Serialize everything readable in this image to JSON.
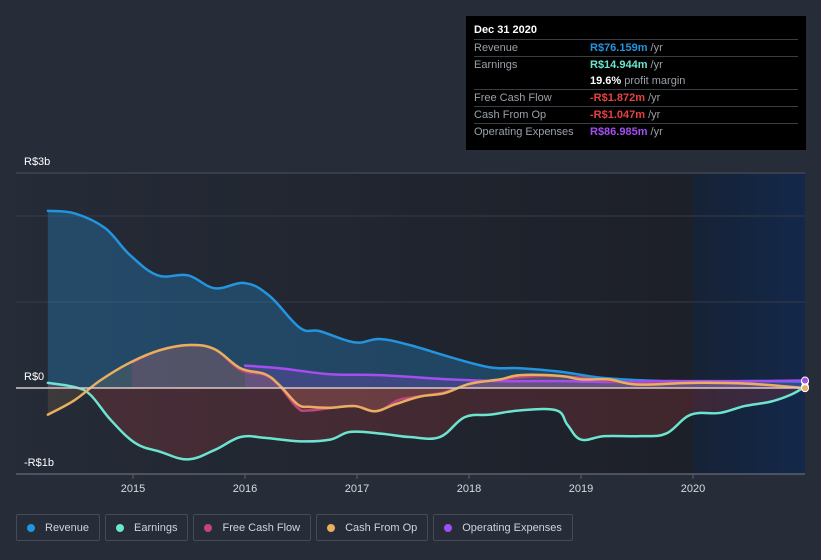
{
  "tooltip": {
    "date": "Dec 31 2020",
    "rows": [
      {
        "label": "Revenue",
        "value": "R$76.159m",
        "unit": " /yr",
        "color": "#2394df"
      },
      {
        "label": "Earnings",
        "value": "R$14.944m",
        "unit": " /yr",
        "color": "#6ce5d0"
      },
      {
        "label": "",
        "value": "19.6%",
        "unit": " profit margin",
        "color": "#ffffff"
      },
      {
        "label": "Free Cash Flow",
        "value": "-R$1.872m",
        "unit": " /yr",
        "color": "#e64141"
      },
      {
        "label": "Cash From Op",
        "value": "-R$1.047m",
        "unit": " /yr",
        "color": "#e64141"
      },
      {
        "label": "Operating Expenses",
        "value": "R$86.985m",
        "unit": " /yr",
        "color": "#a44ef0"
      }
    ]
  },
  "legend": [
    {
      "label": "Revenue",
      "color": "#2394df"
    },
    {
      "label": "Earnings",
      "color": "#6ce5d0"
    },
    {
      "label": "Free Cash Flow",
      "color": "#c0457f"
    },
    {
      "label": "Cash From Op",
      "color": "#e8af5e"
    },
    {
      "label": "Operating Expenses",
      "color": "#a44ef0"
    }
  ],
  "chart_data": {
    "type": "area",
    "title": "",
    "xlabel": "",
    "ylabel": "",
    "y_unit": "R$ billions",
    "ylim": [
      -1,
      2.5
    ],
    "xlim": [
      2014.24,
      2021.0
    ],
    "y_tick_labels": [
      {
        "value": 2.5,
        "label": "R$3b"
      },
      {
        "value": 0,
        "label": "R$0"
      },
      {
        "value": -1,
        "label": "-R$1b"
      }
    ],
    "gridlines": [
      2.5,
      2,
      1,
      0,
      -1
    ],
    "x_ticks": [
      2015,
      2016,
      2017,
      2018,
      2019,
      2020
    ],
    "x_tick_labels": [
      "2015",
      "2016",
      "2017",
      "2018",
      "2019",
      "2020"
    ],
    "highlight_range": [
      2020,
      2021.0
    ],
    "grid": true,
    "legend_position": "bottom-left",
    "series": [
      {
        "name": "Revenue",
        "color": "#2394df",
        "x": [
          2014.24,
          2014.48,
          2014.75,
          2014.97,
          2015.22,
          2015.49,
          2015.73,
          2016.0,
          2016.22,
          2016.49,
          2016.67,
          2016.98,
          2017.2,
          2017.47,
          2017.83,
          2018.19,
          2018.46,
          2018.81,
          2019.17,
          2019.53,
          2020.06,
          2020.5,
          2021.0
        ],
        "values": [
          2.06,
          2.03,
          1.86,
          1.55,
          1.31,
          1.31,
          1.16,
          1.22,
          1.07,
          0.7,
          0.66,
          0.53,
          0.57,
          0.5,
          0.36,
          0.24,
          0.23,
          0.19,
          0.12,
          0.09,
          0.07,
          0.08,
          0.076
        ]
      },
      {
        "name": "Earnings",
        "color": "#6ce5d0",
        "x": [
          2014.24,
          2014.48,
          2014.62,
          2014.8,
          2015.02,
          2015.24,
          2015.49,
          2015.73,
          2015.96,
          2016.18,
          2016.49,
          2016.76,
          2016.94,
          2017.21,
          2017.47,
          2017.74,
          2017.96,
          2018.19,
          2018.46,
          2018.78,
          2018.88,
          2019.0,
          2019.21,
          2019.53,
          2019.76,
          2019.98,
          2020.24,
          2020.46,
          2020.69,
          2020.87,
          2021.0
        ],
        "values": [
          0.06,
          0.01,
          -0.08,
          -0.37,
          -0.64,
          -0.74,
          -0.83,
          -0.72,
          -0.57,
          -0.58,
          -0.62,
          -0.6,
          -0.51,
          -0.53,
          -0.57,
          -0.57,
          -0.34,
          -0.31,
          -0.26,
          -0.26,
          -0.43,
          -0.6,
          -0.56,
          -0.56,
          -0.53,
          -0.31,
          -0.29,
          -0.21,
          -0.16,
          -0.08,
          0.015
        ]
      },
      {
        "name": "Free Cash Flow",
        "color": "#c0457f",
        "x": [
          2014.99,
          2015.24,
          2015.49,
          2015.73,
          2015.96,
          2016.18,
          2016.31,
          2016.47,
          2016.58,
          2016.96,
          2017.18,
          2017.37,
          2017.55,
          2017.78,
          2018.01,
          2018.28,
          2018.64,
          2019.0,
          2019.5,
          2020.0,
          2020.5,
          2021.0
        ],
        "values": [
          0.3,
          0.44,
          0.5,
          0.45,
          0.21,
          0.15,
          0.02,
          -0.23,
          -0.26,
          -0.21,
          -0.27,
          -0.14,
          -0.1,
          -0.05,
          0.05,
          0.1,
          0.14,
          0.12,
          0.05,
          0.06,
          0.05,
          -0.002
        ]
      },
      {
        "name": "Cash From Op",
        "color": "#e8af5e",
        "x": [
          2014.24,
          2014.48,
          2014.71,
          2014.98,
          2015.24,
          2015.51,
          2015.73,
          2015.96,
          2016.18,
          2016.31,
          2016.47,
          2016.58,
          2016.76,
          2016.98,
          2017.16,
          2017.34,
          2017.56,
          2017.78,
          2018.01,
          2018.28,
          2018.46,
          2018.82,
          2019.0,
          2019.25,
          2019.5,
          2020.0,
          2020.5,
          2021.0
        ],
        "values": [
          -0.31,
          -0.14,
          0.09,
          0.3,
          0.44,
          0.5,
          0.45,
          0.23,
          0.16,
          0.03,
          -0.19,
          -0.22,
          -0.23,
          -0.21,
          -0.27,
          -0.19,
          -0.1,
          -0.06,
          0.05,
          0.1,
          0.15,
          0.14,
          0.1,
          0.1,
          0.04,
          0.06,
          0.05,
          -0.001
        ]
      },
      {
        "name": "Operating Expenses",
        "color": "#a44ef0",
        "x": [
          2016.0,
          2016.31,
          2016.76,
          2017.2,
          2017.83,
          2018.28,
          2018.81,
          2019.25,
          2019.7,
          2020.0,
          2020.5,
          2021.0
        ],
        "values": [
          0.26,
          0.23,
          0.16,
          0.15,
          0.1,
          0.08,
          0.08,
          0.07,
          0.08,
          0.08,
          0.08,
          0.087
        ]
      }
    ]
  }
}
